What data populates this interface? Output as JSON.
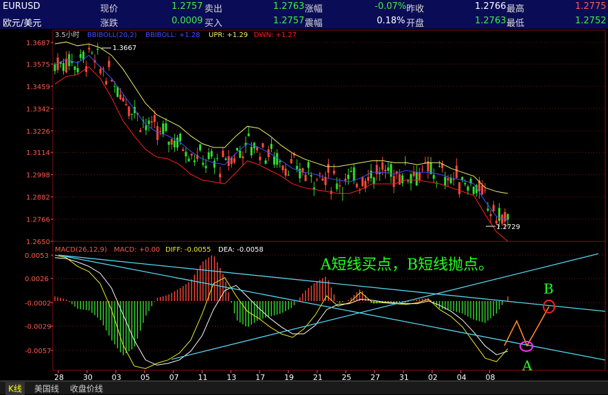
{
  "quote": {
    "symbol": "EURUSD",
    "name": "欧元/美元",
    "row1": [
      {
        "label": "现价",
        "value": "1.2757"
      },
      {
        "label": "卖出",
        "value": "1.2763"
      },
      {
        "label": "涨幅",
        "value": "-0.07%"
      },
      {
        "label": "昨收",
        "value": "1.2766"
      },
      {
        "label": "最高",
        "value": "1.2775"
      }
    ],
    "row2": [
      {
        "label": "涨跌",
        "value": "0.0009"
      },
      {
        "label": "买入",
        "value": "1.2757"
      },
      {
        "label": "震幅",
        "value": "0.18%"
      },
      {
        "label": "开盘",
        "value": "1.2763"
      },
      {
        "label": "最低",
        "value": "1.2752"
      }
    ]
  },
  "colors": {
    "up": "#ff4a3a",
    "down": "#2fe02f",
    "boll_mid": "#4050ff",
    "boll_upper": "#f0f070",
    "boll_lower": "#ff2020",
    "diff": "#f0f020",
    "dea": "#ffffff",
    "trendline": "#55d8f0",
    "grid": "#8a1010",
    "annotation": "#20ff20"
  },
  "price_panel": {
    "period": "3.5小时",
    "legend": [
      {
        "text": "BBIBOLL(20,2)",
        "color": "#4050ff"
      },
      {
        "text": "BBIBOLL: +1.28",
        "color": "#4050ff"
      },
      {
        "text": "UPR: +1.29",
        "color": "#f0f070"
      },
      {
        "text": "DWN: +1.27",
        "color": "#ff2020"
      }
    ],
    "y_ticks": [
      "1.3687",
      "1.3575",
      "1.3459",
      "1.3342",
      "1.3226",
      "1.3114",
      "1.2998",
      "1.2882",
      "1.2766",
      "1.2650"
    ],
    "marker_high": "1.3667",
    "marker_low": "1.2729"
  },
  "macd_panel": {
    "legend": [
      {
        "text": "MACD(26,12,9)",
        "color": "#ff5a4a"
      },
      {
        "text": "MACD: +0.00",
        "color": "#ff5a4a"
      },
      {
        "text": "DIFF: -0.0055",
        "color": "#f0f020"
      },
      {
        "text": "DEA: -0.0058",
        "color": "#ffffff"
      }
    ],
    "y_ticks": [
      "0.0053",
      "0.0026",
      "-0.0002",
      "-0.0029",
      "-0.0057"
    ],
    "annotation_main": "A短线买点，B短线抛点。",
    "label_a": "A",
    "label_b": "B"
  },
  "x_ticks": [
    "28",
    "30",
    "03",
    "05",
    "07",
    "11",
    "13",
    "17",
    "19",
    "21",
    "25",
    "27",
    "31",
    "02",
    "04",
    "08"
  ],
  "tabs": [
    {
      "label": "K线",
      "active": true
    },
    {
      "label": "美国线",
      "active": false
    },
    {
      "label": "收盘价线",
      "active": false
    }
  ],
  "chart_data": {
    "type": "line",
    "series": [
      {
        "name": "BBIBOLL",
        "values": [
          1.357,
          1.36,
          1.358,
          1.362,
          1.356,
          1.35,
          1.342,
          1.334,
          1.326,
          1.322,
          1.32,
          1.317,
          1.312,
          1.308,
          1.306,
          1.305,
          1.311,
          1.316,
          1.314,
          1.311,
          1.307,
          1.303,
          1.301,
          1.3,
          1.298,
          1.297,
          1.296,
          1.298,
          1.301,
          1.301,
          1.3,
          1.302,
          1.301,
          1.301,
          1.3,
          1.298,
          1.297,
          1.295,
          1.286,
          1.278,
          1.276
        ]
      },
      {
        "name": "UPR",
        "values": [
          1.368,
          1.369,
          1.367,
          1.368,
          1.366,
          1.362,
          1.355,
          1.346,
          1.337,
          1.331,
          1.328,
          1.325,
          1.32,
          1.316,
          1.314,
          1.314,
          1.32,
          1.325,
          1.324,
          1.32,
          1.315,
          1.311,
          1.308,
          1.306,
          1.304,
          1.304,
          1.305,
          1.306,
          1.307,
          1.307,
          1.306,
          1.306,
          1.305,
          1.306,
          1.306,
          1.303,
          1.301,
          1.299,
          1.293,
          1.291,
          1.29
        ]
      },
      {
        "name": "DWN",
        "values": [
          1.347,
          1.351,
          1.352,
          1.356,
          1.35,
          1.34,
          1.328,
          1.32,
          1.313,
          1.309,
          1.308,
          1.305,
          1.3,
          1.297,
          1.296,
          1.295,
          1.301,
          1.307,
          1.305,
          1.302,
          1.299,
          1.295,
          1.293,
          1.292,
          1.291,
          1.29,
          1.29,
          1.292,
          1.295,
          1.295,
          1.295,
          1.297,
          1.297,
          1.296,
          1.295,
          1.293,
          1.291,
          1.289,
          1.279,
          1.27,
          1.265
        ]
      },
      {
        "name": "DIFF",
        "values": [
          0.0053,
          0.005,
          0.004,
          0.0034,
          0.002,
          -0.001,
          -0.005,
          -0.0075,
          -0.0078,
          -0.0072,
          -0.0068,
          -0.006,
          -0.0045,
          -0.0015,
          0.002,
          0.0027,
          0.0006,
          -0.0012,
          -0.002,
          -0.003,
          -0.0038,
          -0.0042,
          -0.0032,
          -0.0016,
          0.0006,
          -0.0006,
          -0.0002,
          0.001,
          -0.0001,
          -0.0002,
          -0.0003,
          -0.0004,
          -0.0002,
          0.0002,
          -0.001,
          -0.0018,
          -0.003,
          -0.0048,
          -0.0066,
          -0.007,
          -0.0055
        ]
      },
      {
        "name": "DEA",
        "values": [
          0.005,
          0.0049,
          0.0045,
          0.004,
          0.0032,
          0.0015,
          -0.0015,
          -0.0045,
          -0.0068,
          -0.0074,
          -0.0072,
          -0.0068,
          -0.0058,
          -0.004,
          -0.001,
          0.0012,
          0.0018,
          0.0005,
          -0.0008,
          -0.002,
          -0.003,
          -0.0038,
          -0.0038,
          -0.0028,
          -0.001,
          -0.0004,
          -0.0003,
          0.0002,
          0.0001,
          -0.0001,
          -0.0002,
          -0.0003,
          -0.0003,
          0.0,
          -0.0005,
          -0.0012,
          -0.0022,
          -0.0036,
          -0.0052,
          -0.0062,
          -0.0058
        ]
      }
    ],
    "ylim_price": [
      1.265,
      1.3687
    ],
    "ylim_macd": [
      -0.008,
      0.0053
    ]
  }
}
